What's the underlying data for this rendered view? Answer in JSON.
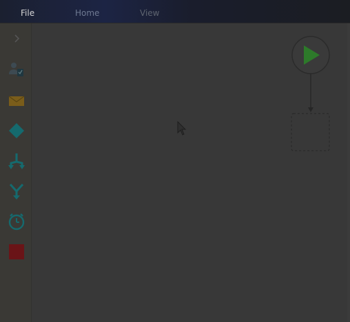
{
  "menu": {
    "file_label": "File",
    "home_label": "Home",
    "view_label": "View"
  },
  "toolbox": {
    "items": [
      {
        "icon": "chevron-right-icon"
      },
      {
        "icon": "user-task-icon"
      },
      {
        "icon": "envelope-icon"
      },
      {
        "icon": "diamond-gateway-icon"
      },
      {
        "icon": "split-flow-icon"
      },
      {
        "icon": "merge-flow-icon"
      },
      {
        "icon": "timer-icon"
      },
      {
        "icon": "stop-square-icon"
      }
    ]
  },
  "canvas": {
    "nodes": [
      {
        "type": "start-event",
        "icon": "play-icon"
      },
      {
        "type": "placeholder-step"
      }
    ]
  },
  "colors": {
    "play_green": "#2d7a2a",
    "teal_accent": "#1e6e73",
    "gold_accent": "#8a6a1c",
    "red_accent": "#6e1518"
  }
}
